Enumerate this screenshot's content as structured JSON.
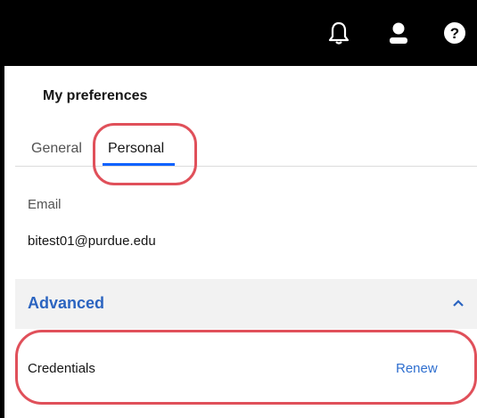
{
  "topbar": {
    "icons": [
      "bell-icon",
      "user-icon",
      "help-icon"
    ],
    "background": "#000000"
  },
  "panel": {
    "title": "My preferences",
    "tabs": [
      {
        "label": "General",
        "active": false
      },
      {
        "label": "Personal",
        "active": true
      }
    ],
    "email": {
      "label": "Email",
      "value": "bitest01@purdue.edu"
    },
    "advanced": {
      "title": "Advanced",
      "expanded": true,
      "credentials_label": "Credentials",
      "renew_label": "Renew"
    }
  },
  "colors": {
    "accent": "#0f62fe",
    "link": "#2f6fcf",
    "annotation": "#e0505a"
  }
}
